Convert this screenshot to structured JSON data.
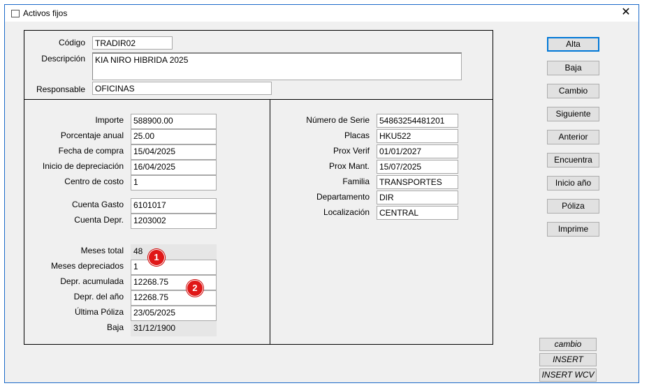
{
  "window": {
    "title": "Activos fijos",
    "close_glyph": "✕"
  },
  "header": {
    "codigo_label": "Código",
    "codigo_value": "TRADIR02",
    "descripcion_label": "Descripción",
    "descripcion_value": "KIA NIRO HIBRIDA 2025",
    "responsable_label": "Responsable",
    "responsable_value": "OFICINAS"
  },
  "left": {
    "importe_label": "Importe",
    "importe_value": "588900.00",
    "porcentaje_label": "Porcentaje anual",
    "porcentaje_value": "25.00",
    "fecha_compra_label": "Fecha de compra",
    "fecha_compra_value": "15/04/2025",
    "inicio_dep_label": "Inicio de depreciación",
    "inicio_dep_value": "16/04/2025",
    "centro_costo_label": "Centro de costo",
    "centro_costo_value": "1",
    "cuenta_gasto_label": "Cuenta Gasto",
    "cuenta_gasto_value": "6101017",
    "cuenta_depr_label": "Cuenta Depr.",
    "cuenta_depr_value": "1203002",
    "meses_total_label": "Meses total",
    "meses_total_value": "48",
    "meses_dep_label": "Meses depreciados",
    "meses_dep_value": "1",
    "depr_acum_label": "Depr. acumulada",
    "depr_acum_value": "12268.75",
    "depr_anio_label": "Depr. del año",
    "depr_anio_value": "12268.75",
    "ultima_poliza_label": "Última Póliza",
    "ultima_poliza_value": "23/05/2025",
    "baja_label": "Baja",
    "baja_value": "31/12/1900"
  },
  "right": {
    "serie_label": "Número de Serie",
    "serie_value": "54863254481201",
    "placas_label": "Placas",
    "placas_value": "HKU522",
    "prox_verif_label": "Prox Verif",
    "prox_verif_value": "01/01/2027",
    "prox_mant_label": "Prox Mant.",
    "prox_mant_value": "15/07/2025",
    "familia_label": "Familia",
    "familia_value": "TRANSPORTES",
    "departamento_label": "Departamento",
    "departamento_value": "DIR",
    "localizacion_label": "Localización",
    "localizacion_value": "CENTRAL"
  },
  "buttons": {
    "alta": "Alta",
    "baja": "Baja",
    "cambio": "Cambio",
    "siguiente": "Siguiente",
    "anterior": "Anterior",
    "encuentra": "Encuentra",
    "inicio_anio": "Inicio año",
    "poliza": "Póliza",
    "imprime": "Imprime"
  },
  "status_buttons": {
    "cambio": "cambio",
    "insert": "INSERT",
    "insert_wcv": "INSERT WCV"
  },
  "annotations": {
    "badge1": "1",
    "badge2": "2",
    "badge_color": "#e01818"
  }
}
